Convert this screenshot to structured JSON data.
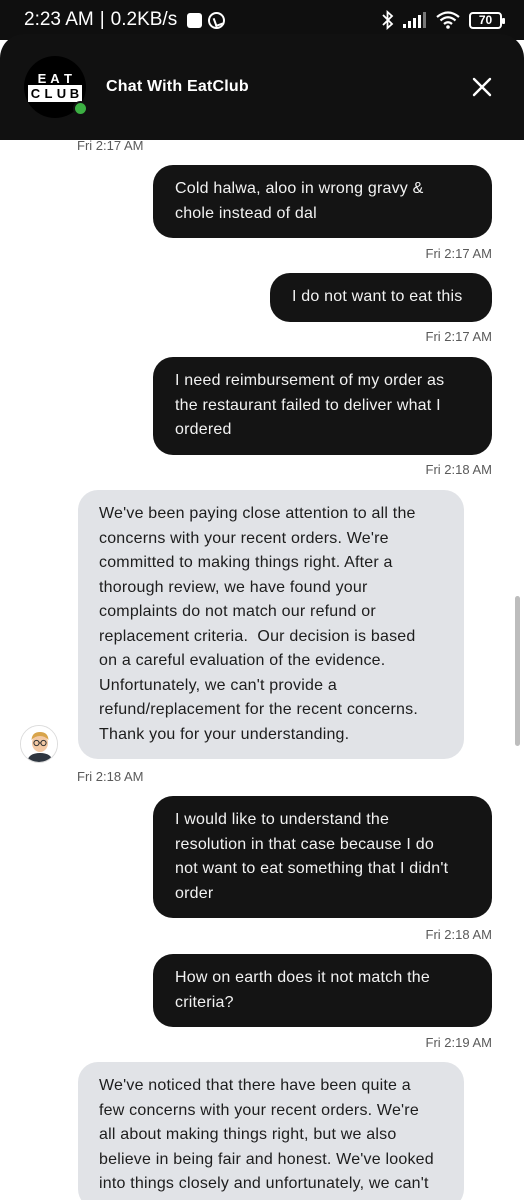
{
  "status_bar": {
    "time": "2:23 AM",
    "separator": "|",
    "network_speed": "0.2KB/s",
    "battery": "70",
    "icons": [
      "app-notification-icon",
      "whatsapp-icon",
      "bluetooth-icon",
      "signal-icon",
      "wifi-icon",
      "battery-icon"
    ]
  },
  "header": {
    "logo_text_top": "EAT",
    "logo_text_bottom": "CLUB",
    "title": "Chat With EatClub",
    "online_color": "#3cb043"
  },
  "messages": [
    {
      "kind": "timestamp",
      "side": "left",
      "text": "Fri 2:17 AM"
    },
    {
      "kind": "message",
      "side": "out",
      "lines": [
        "Cold halwa, aloo in wrong gravy &",
        "chole instead of dal"
      ]
    },
    {
      "kind": "timestamp",
      "side": "right",
      "text": "Fri 2:17 AM"
    },
    {
      "kind": "message",
      "side": "out",
      "lines": [
        "I do not want to eat this"
      ]
    },
    {
      "kind": "timestamp",
      "side": "right",
      "text": "Fri 2:17 AM"
    },
    {
      "kind": "message",
      "side": "out",
      "lines": [
        "I need reimbursement of my order as",
        "the restaurant failed to deliver what I",
        "ordered"
      ]
    },
    {
      "kind": "timestamp",
      "side": "right",
      "text": "Fri 2:18 AM"
    },
    {
      "kind": "message",
      "side": "in",
      "lines": [
        "We've been paying close attention to all the",
        "concerns with your recent orders. We're",
        "committed to making things right. After a",
        "thorough review, we have found your",
        "complaints do not match our refund or",
        "replacement criteria.  Our decision is based",
        "on a careful evaluation of the evidence.",
        "Unfortunately, we can't provide a",
        "refund/replacement for the recent concerns.",
        "Thank you for your understanding."
      ]
    },
    {
      "kind": "timestamp",
      "side": "left",
      "text": "Fri 2:18 AM"
    },
    {
      "kind": "message",
      "side": "out",
      "lines": [
        "I would like to understand the",
        "resolution in that case because I do",
        "not want to eat something that I didn't",
        "order"
      ]
    },
    {
      "kind": "timestamp",
      "side": "right",
      "text": "Fri 2:18 AM"
    },
    {
      "kind": "message",
      "side": "out",
      "lines": [
        "How on earth does it not match the",
        "criteria?"
      ]
    },
    {
      "kind": "timestamp",
      "side": "right",
      "text": "Fri 2:19 AM"
    },
    {
      "kind": "message",
      "side": "in",
      "lines": [
        "We've noticed that there have been quite a",
        "few concerns with your recent orders. We're",
        "all about making things right, but we also",
        "believe in being fair and honest. We've looked",
        "into things closely and unfortunately, we can't"
      ]
    }
  ],
  "colors": {
    "header_bg": "#111111",
    "outgoing_bubble": "#141414",
    "incoming_bubble": "#e1e3e7"
  }
}
